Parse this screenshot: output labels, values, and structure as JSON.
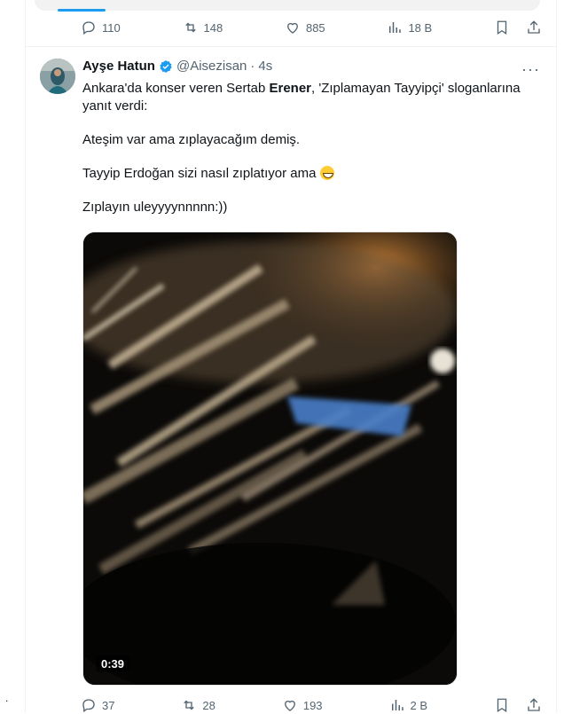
{
  "previous_tweet": {
    "actions": {
      "replies": "110",
      "retweets": "148",
      "likes": "885",
      "views": "18 B"
    }
  },
  "tweet": {
    "author_name": "Ayşe Hatun",
    "verified": true,
    "handle": "@Aisezisan",
    "separator": "·",
    "time": "4s",
    "more_label": "···",
    "text": {
      "line1_pre": "Ankara'da konser veren Sertab ",
      "line1_bold": "Erener",
      "line1_post": ", 'Zıplamayan Tayyipçi' sloganlarına yanıt verdi:",
      "line2": "Ateşim var ama zıplayacağım demiş.",
      "line3": "Tayyip Erdoğan sizi nasıl zıplatıyor ama",
      "line4": "Zıplayın uleyyyynnnnn:))"
    },
    "video": {
      "duration": "0:39"
    },
    "actions": {
      "replies": "37",
      "retweets": "28",
      "likes": "193",
      "views": "2 B"
    }
  },
  "colors": {
    "accent": "#1d9bf0",
    "muted": "#536471",
    "text": "#0f1419"
  },
  "stray_mark": "."
}
